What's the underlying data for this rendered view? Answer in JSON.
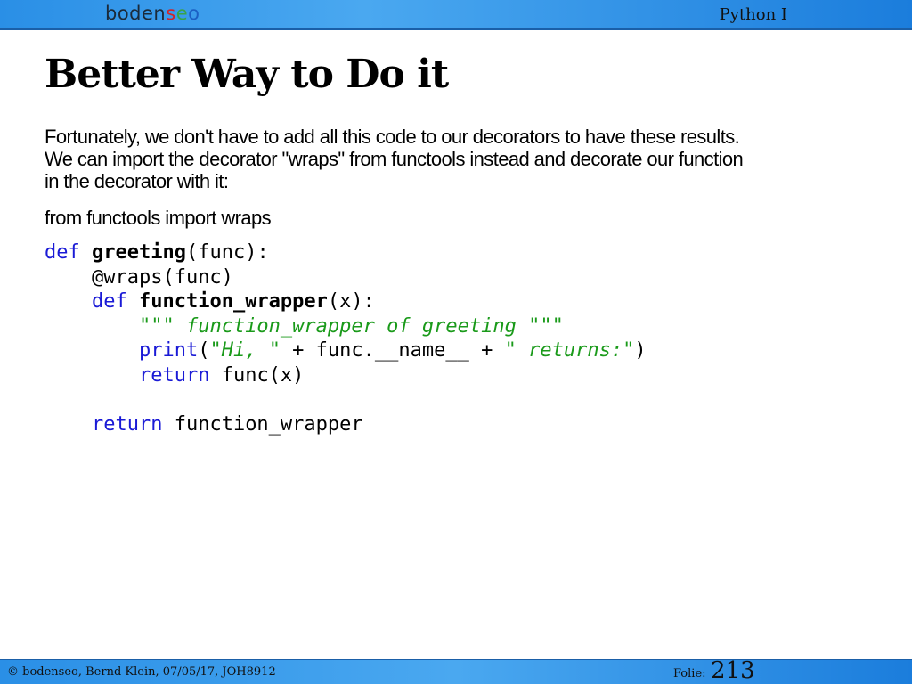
{
  "header": {
    "logo_text": "bodenseo",
    "course": "Python I"
  },
  "slide": {
    "title": "Better Way to Do it",
    "intro_lines": [
      "Fortunately, we don't have to add all this code to our decorators to have these results.",
      "We can import the decorator \"wraps\" from functools instead and decorate our function",
      "in the decorator with it:"
    ],
    "import_line": "from functools import wraps"
  },
  "code": {
    "line1": {
      "kw": "def",
      "fn": "greeting",
      "rest": "(func):"
    },
    "line2": {
      "text": "@wraps(func)"
    },
    "line3": {
      "kw": "def",
      "fn": "function_wrapper",
      "rest": "(x):"
    },
    "line4": {
      "open": "\"\"\"",
      "doc": " function_wrapper of greeting ",
      "close": "\"\"\""
    },
    "line5": {
      "kw": "print",
      "p1": "(",
      "q1": "\"",
      "s1": "Hi, ",
      "q2": "\"",
      "mid": " + func.__name__ + ",
      "q3": "\"",
      "s2": " returns:",
      "q4": "\"",
      "p2": ")"
    },
    "line6": {
      "kw": "return",
      "rest": "func(x)"
    },
    "line8": {
      "kw": "return",
      "rest": "function_wrapper"
    }
  },
  "footer": {
    "copyright": "© bodenseo, Bernd Klein, 07/05/17, JOH8912",
    "folie_label": "Folie:",
    "folie_number": "213"
  },
  "colors": {
    "keyword": "#1a1ad6",
    "string": "#1a9a1a",
    "bar": "#2a8fe6"
  }
}
